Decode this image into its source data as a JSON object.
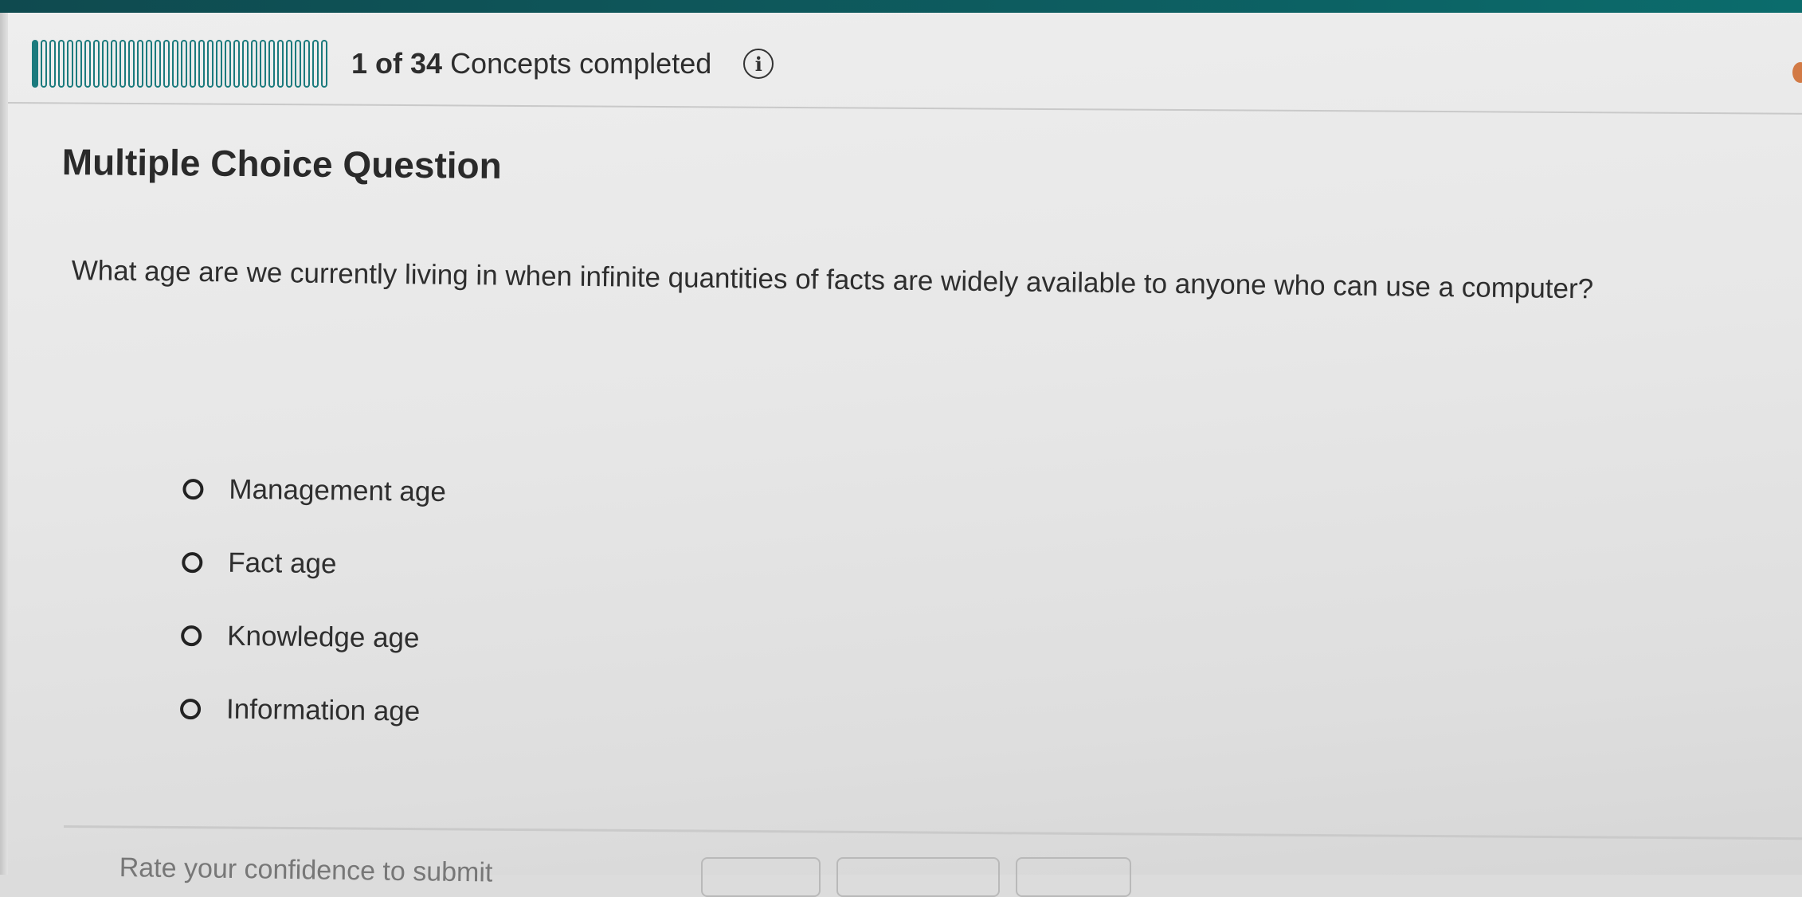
{
  "progress": {
    "count_label": "1 of 34",
    "suffix_label": "Concepts completed",
    "completed": 1,
    "total": 34,
    "accent_color": "#1b7a7d"
  },
  "info_button": {
    "icon": "info-icon",
    "glyph": "i"
  },
  "question": {
    "type_label": "Multiple Choice Question",
    "text": "What age are we currently living in when infinite quantities of facts are widely available to anyone who can use a computer?"
  },
  "options": [
    {
      "label": "Management age",
      "selected": false
    },
    {
      "label": "Fact age",
      "selected": false
    },
    {
      "label": "Knowledge age",
      "selected": false
    },
    {
      "label": "Information age",
      "selected": false
    }
  ],
  "footer": {
    "rate_label": "Rate your confidence to submit"
  }
}
